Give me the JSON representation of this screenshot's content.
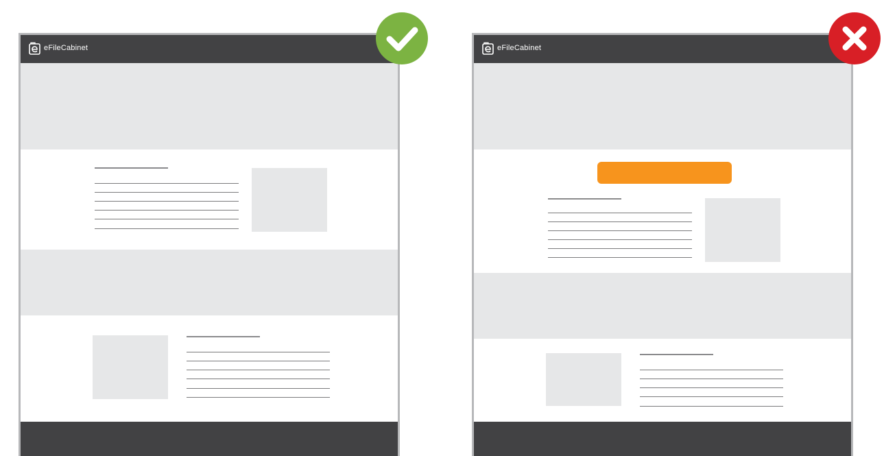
{
  "brand": {
    "name": "eFileCabinet"
  },
  "colors": {
    "header": "#424244",
    "band": "#e6e7e8",
    "cta": "#f7941d",
    "good": "#7cb342",
    "bad": "#d81f26"
  },
  "mockups": [
    {
      "variant": "correct",
      "badge_icon": "checkmark-icon"
    },
    {
      "variant": "incorrect",
      "badge_icon": "x-mark-icon"
    }
  ]
}
